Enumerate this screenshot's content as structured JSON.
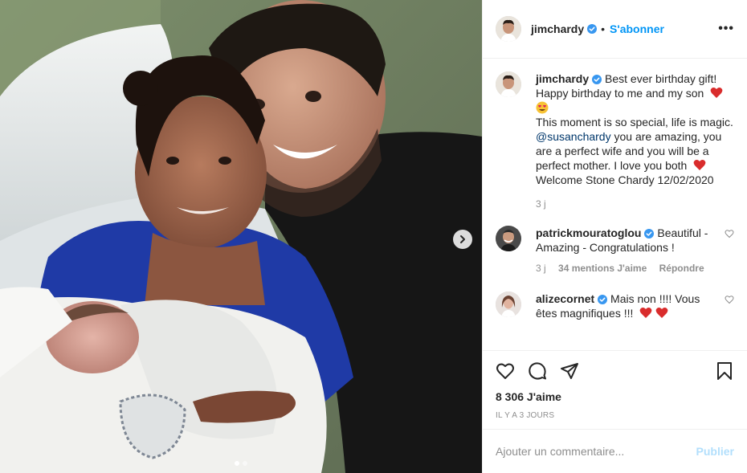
{
  "post": {
    "author": "jimchardy",
    "follow_label": "S'abonner",
    "bullet": "•",
    "more": "•••"
  },
  "caption": {
    "author": "jimchardy",
    "line1": "Best ever birthday gift!",
    "line2": "Happy birthday to me and my son",
    "line3": "This moment is so special, life is magic.",
    "mention": "@susanchardy",
    "line4": " you are amazing, you are a perfect wife and you will be a perfect mother. I love you both",
    "line5": "Welcome Stone Chardy 12/02/2020",
    "time": "3 j"
  },
  "comments": [
    {
      "author": "patrickmouratoglou",
      "text": "Beautiful - Amazing - Congratulations !",
      "time": "3 j",
      "likes": "34 mentions J'aime",
      "reply": "Répondre"
    },
    {
      "author": "alizecornet",
      "text": "Mais non !!!! Vous êtes magnifiques !!!"
    }
  ],
  "stats": {
    "likes": "8 306 J'aime",
    "date": "IL Y A 3 JOURS"
  },
  "add_comment": {
    "placeholder": "Ajouter un commentaire...",
    "publish": "Publier"
  },
  "icons": {
    "verified": "verified-badge-icon",
    "heart": "heart-icon",
    "comment": "comment-icon",
    "share": "share-icon",
    "save": "bookmark-icon",
    "next": "chevron-right-icon"
  },
  "colors": {
    "link": "#0095f6",
    "mention": "#00376b",
    "muted": "#8e8e8e",
    "heart_red": "#e0245e"
  },
  "carousel": {
    "slides": 2,
    "active": 1
  }
}
